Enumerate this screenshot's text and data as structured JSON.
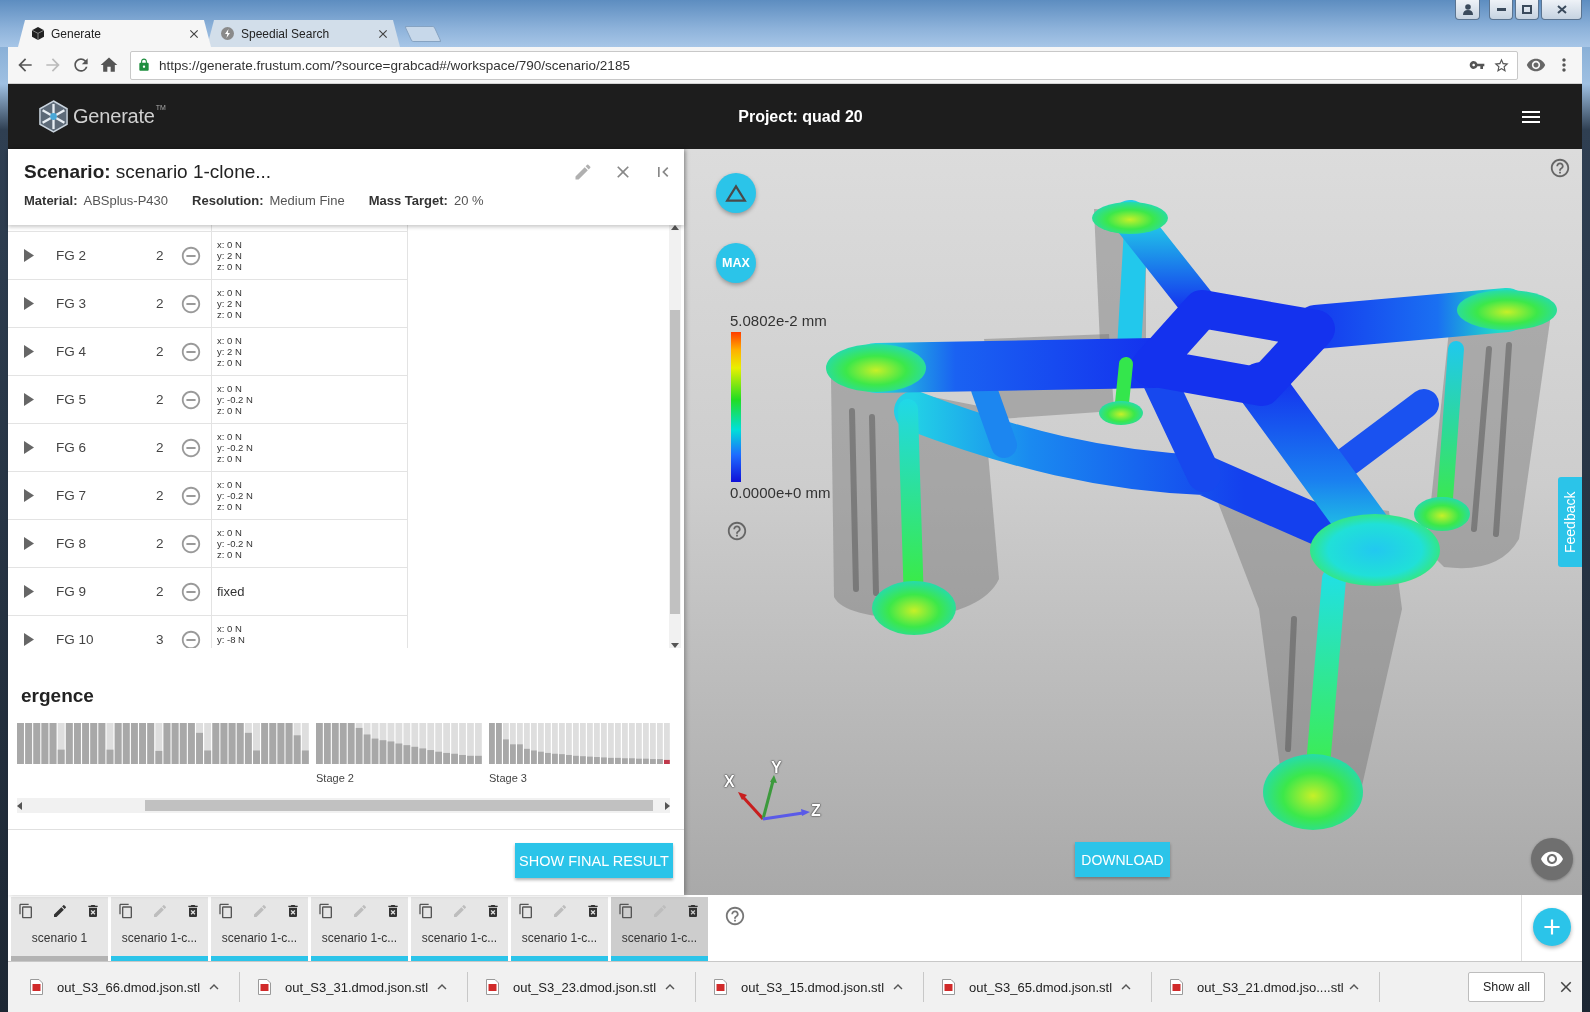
{
  "browser": {
    "tabs": [
      {
        "title": "Generate",
        "selected": true
      },
      {
        "title": "Speedial Search",
        "selected": false
      }
    ],
    "url": "https://generate.frustum.com/?source=grabcad#/workspace/790/scenario/2185"
  },
  "app_header": {
    "logo": "Generate",
    "trademark": "TM",
    "project": "Project: quad 20"
  },
  "scenario_panel": {
    "title": "**Scenario:** scenario 1-clone...",
    "properties": [
      {
        "label": "Material:",
        "value": "ABSplus-P430"
      },
      {
        "label": "Resolution:",
        "value": "Medium Fine"
      },
      {
        "label": "Mass Target:",
        "value": "20 %"
      }
    ],
    "force_groups": [
      {
        "name": "FG 2",
        "count": "2",
        "kind": "force",
        "forces": [
          "x: 0 N",
          "y: 2 N",
          "z: 0 N"
        ]
      },
      {
        "name": "FG 3",
        "count": "2",
        "kind": "force",
        "forces": [
          "x: 0 N",
          "y: 2 N",
          "z: 0 N"
        ]
      },
      {
        "name": "FG 4",
        "count": "2",
        "kind": "force",
        "forces": [
          "x: 0 N",
          "y: 2 N",
          "z: 0 N"
        ]
      },
      {
        "name": "FG 5",
        "count": "2",
        "kind": "force",
        "forces": [
          "x: 0 N",
          "y: -0.2 N",
          "z: 0 N"
        ]
      },
      {
        "name": "FG 6",
        "count": "2",
        "kind": "force",
        "forces": [
          "x: 0 N",
          "y: -0.2 N",
          "z: 0 N"
        ]
      },
      {
        "name": "FG 7",
        "count": "2",
        "kind": "force",
        "forces": [
          "x: 0 N",
          "y: -0.2 N",
          "z: 0 N"
        ]
      },
      {
        "name": "FG 8",
        "count": "2",
        "kind": "force",
        "forces": [
          "x: 0 N",
          "y: -0.2 N",
          "z: 0 N"
        ]
      },
      {
        "name": "FG 9",
        "count": "2",
        "kind": "fixed",
        "forces": [
          "fixed"
        ]
      },
      {
        "name": "FG 10",
        "count": "3",
        "kind": "force",
        "forces": [
          "x: 0 N",
          "y: -8 N"
        ]
      }
    ],
    "convergence": {
      "title": "ergence",
      "stage_labels": [
        "Stage 2",
        "Stage 3"
      ]
    },
    "show_final_result_button": "SHOW FINAL RESULT"
  },
  "viewer": {
    "max_button": "MAX",
    "legend": {
      "max_label": "5.0802e-2 mm",
      "min_label": "0.0000e+0 mm"
    },
    "axes": [
      "X",
      "Y",
      "Z"
    ],
    "download_button": "DOWNLOAD",
    "feedback_tab": "Feedback"
  },
  "scenario_tabs": [
    {
      "label": "scenario 1",
      "completed": false,
      "selected": false
    },
    {
      "label": "scenario 1-c...",
      "completed": true,
      "selected": false
    },
    {
      "label": "scenario 1-c...",
      "completed": true,
      "selected": false
    },
    {
      "label": "scenario 1-c...",
      "completed": true,
      "selected": false
    },
    {
      "label": "scenario 1-c...",
      "completed": true,
      "selected": false
    },
    {
      "label": "scenario 1-c...",
      "completed": true,
      "selected": false
    },
    {
      "label": "scenario 1-c...",
      "completed": true,
      "selected": true
    }
  ],
  "downloads": {
    "files": [
      "out_S3_66.dmod.json.stl",
      "out_S3_31.dmod.json.stl",
      "out_S3_23.dmod.json.stl",
      "out_S3_15.dmod.json.stl",
      "out_S3_65.dmod.json.stl",
      "out_S3_21.dmod.jso....stl"
    ],
    "show_all_button": "Show all"
  }
}
